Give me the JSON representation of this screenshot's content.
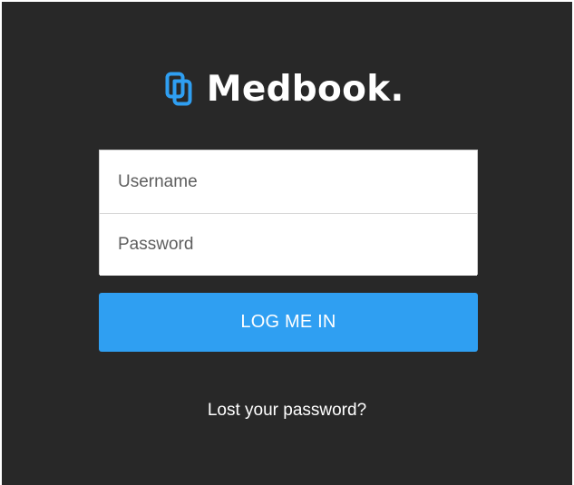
{
  "brand": {
    "name": "Medbook",
    "dot": ".",
    "icon": "medbook-logo-icon",
    "accent_color": "#2f9ff2"
  },
  "login_form": {
    "username_placeholder": "Username",
    "password_placeholder": "Password",
    "submit_label": "LOG ME IN",
    "lost_password_label": "Lost your password?"
  },
  "colors": {
    "background": "#282828",
    "button": "#2f9ff2",
    "text_light": "#ffffff"
  }
}
